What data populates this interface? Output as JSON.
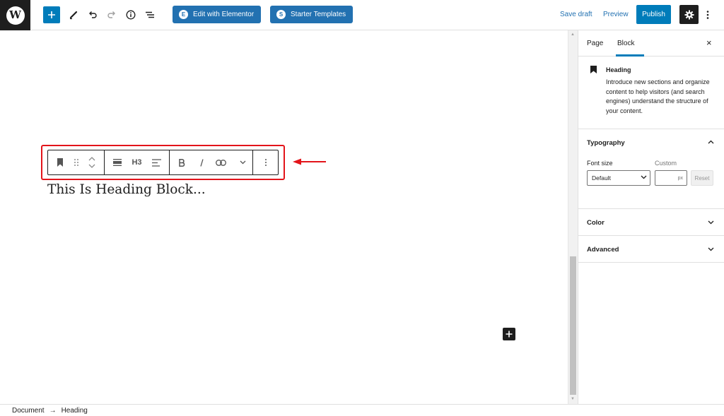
{
  "topbar": {
    "logo_letter": "W",
    "elementor_button": "Edit with Elementor",
    "elementor_icon_letter": "E",
    "starter_templates_button": "Starter Templates",
    "starter_icon_letter": "S",
    "save_draft": "Save draft",
    "preview": "Preview",
    "publish": "Publish",
    "icons": [
      "add-block-icon",
      "edit-tools-icon",
      "undo-icon",
      "redo-icon",
      "info-icon",
      "list-view-icon",
      "gear-icon",
      "more-options-icon"
    ]
  },
  "block_toolbar": {
    "heading_level": "H3",
    "icons": [
      "bookmark-icon",
      "drag-handle-icon",
      "move-up-icon",
      "move-down-icon",
      "align-wide-icon",
      "text-align-icon",
      "bold-icon",
      "italic-icon",
      "link-icon",
      "more-rich-text-icon",
      "block-options-icon"
    ]
  },
  "editor": {
    "heading_text": "This Is Heading Block..."
  },
  "sidebar": {
    "tab_page": "Page",
    "tab_block": "Block",
    "active_tab": "Block",
    "close": "×",
    "block_title": "Heading",
    "block_description": "Introduce new sections and organize content to help visitors (and search engines) understand the structure of your content.",
    "typography": {
      "title": "Typography",
      "font_size_label": "Font size",
      "custom_label": "Custom",
      "font_size_value": "Default",
      "custom_unit": "px",
      "reset": "Reset"
    },
    "color_panel": "Color",
    "advanced_panel": "Advanced"
  },
  "footer": {
    "breadcrumb_root": "Document",
    "separator": "→",
    "breadcrumb_current": "Heading"
  },
  "colors": {
    "primary": "#007cba",
    "button_blue": "#2271b1",
    "dark": "#1e1e1e",
    "highlight_red": "#e3141a"
  }
}
